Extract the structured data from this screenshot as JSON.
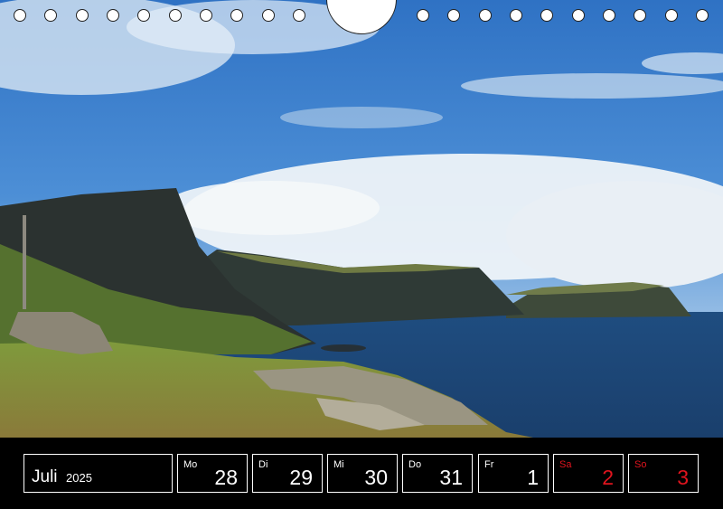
{
  "calendar": {
    "month": "Juli",
    "year": "2025",
    "days": [
      {
        "weekday": "Mo",
        "date": "28",
        "weekend": false
      },
      {
        "weekday": "Di",
        "date": "29",
        "weekend": false
      },
      {
        "weekday": "Mi",
        "date": "30",
        "weekend": false
      },
      {
        "weekday": "Do",
        "date": "31",
        "weekend": false
      },
      {
        "weekday": "Fr",
        "date": "1",
        "weekend": false
      },
      {
        "weekday": "Sa",
        "date": "2",
        "weekend": true
      },
      {
        "weekday": "So",
        "date": "3",
        "weekend": true
      }
    ],
    "colors": {
      "weekday_text": "#ffffff",
      "weekend_text": "#e0141e",
      "strip_background": "#000000"
    }
  }
}
